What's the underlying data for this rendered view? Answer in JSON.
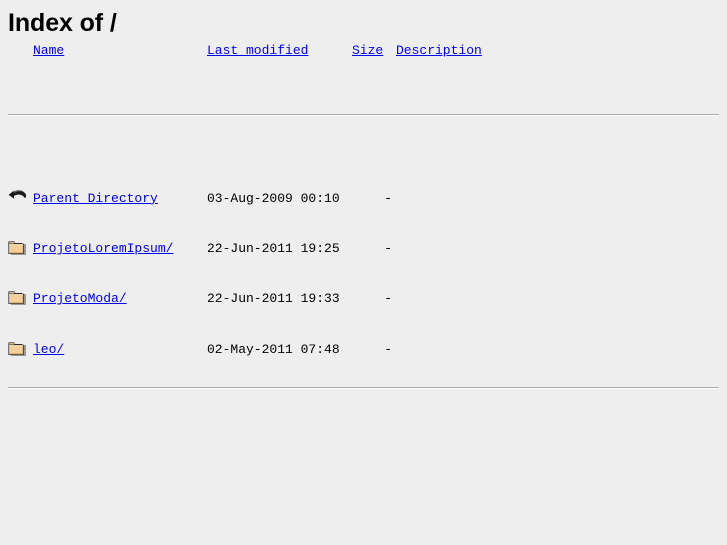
{
  "page": {
    "title": "Index of /",
    "background_color": "#eeeeee",
    "link_color": "#0000ee",
    "text_color": "#000000",
    "rule_color": "#aaaaaa"
  },
  "columns": {
    "name": "Name",
    "last_modified": "Last modified",
    "size": "Size",
    "description": "Description"
  },
  "entries": [
    {
      "icon": "back-icon",
      "name": "Parent Directory",
      "last_modified": "03-Aug-2009 00:10",
      "size": "-",
      "description": ""
    },
    {
      "icon": "folder-icon",
      "name": "ProjetoLoremIpsum/",
      "last_modified": "22-Jun-2011 19:25",
      "size": "-",
      "description": ""
    },
    {
      "icon": "folder-icon",
      "name": "ProjetoModa/",
      "last_modified": "22-Jun-2011 19:33",
      "size": "-",
      "description": ""
    },
    {
      "icon": "folder-icon",
      "name": "leo/",
      "last_modified": "02-May-2011 07:48",
      "size": "-",
      "description": ""
    }
  ]
}
